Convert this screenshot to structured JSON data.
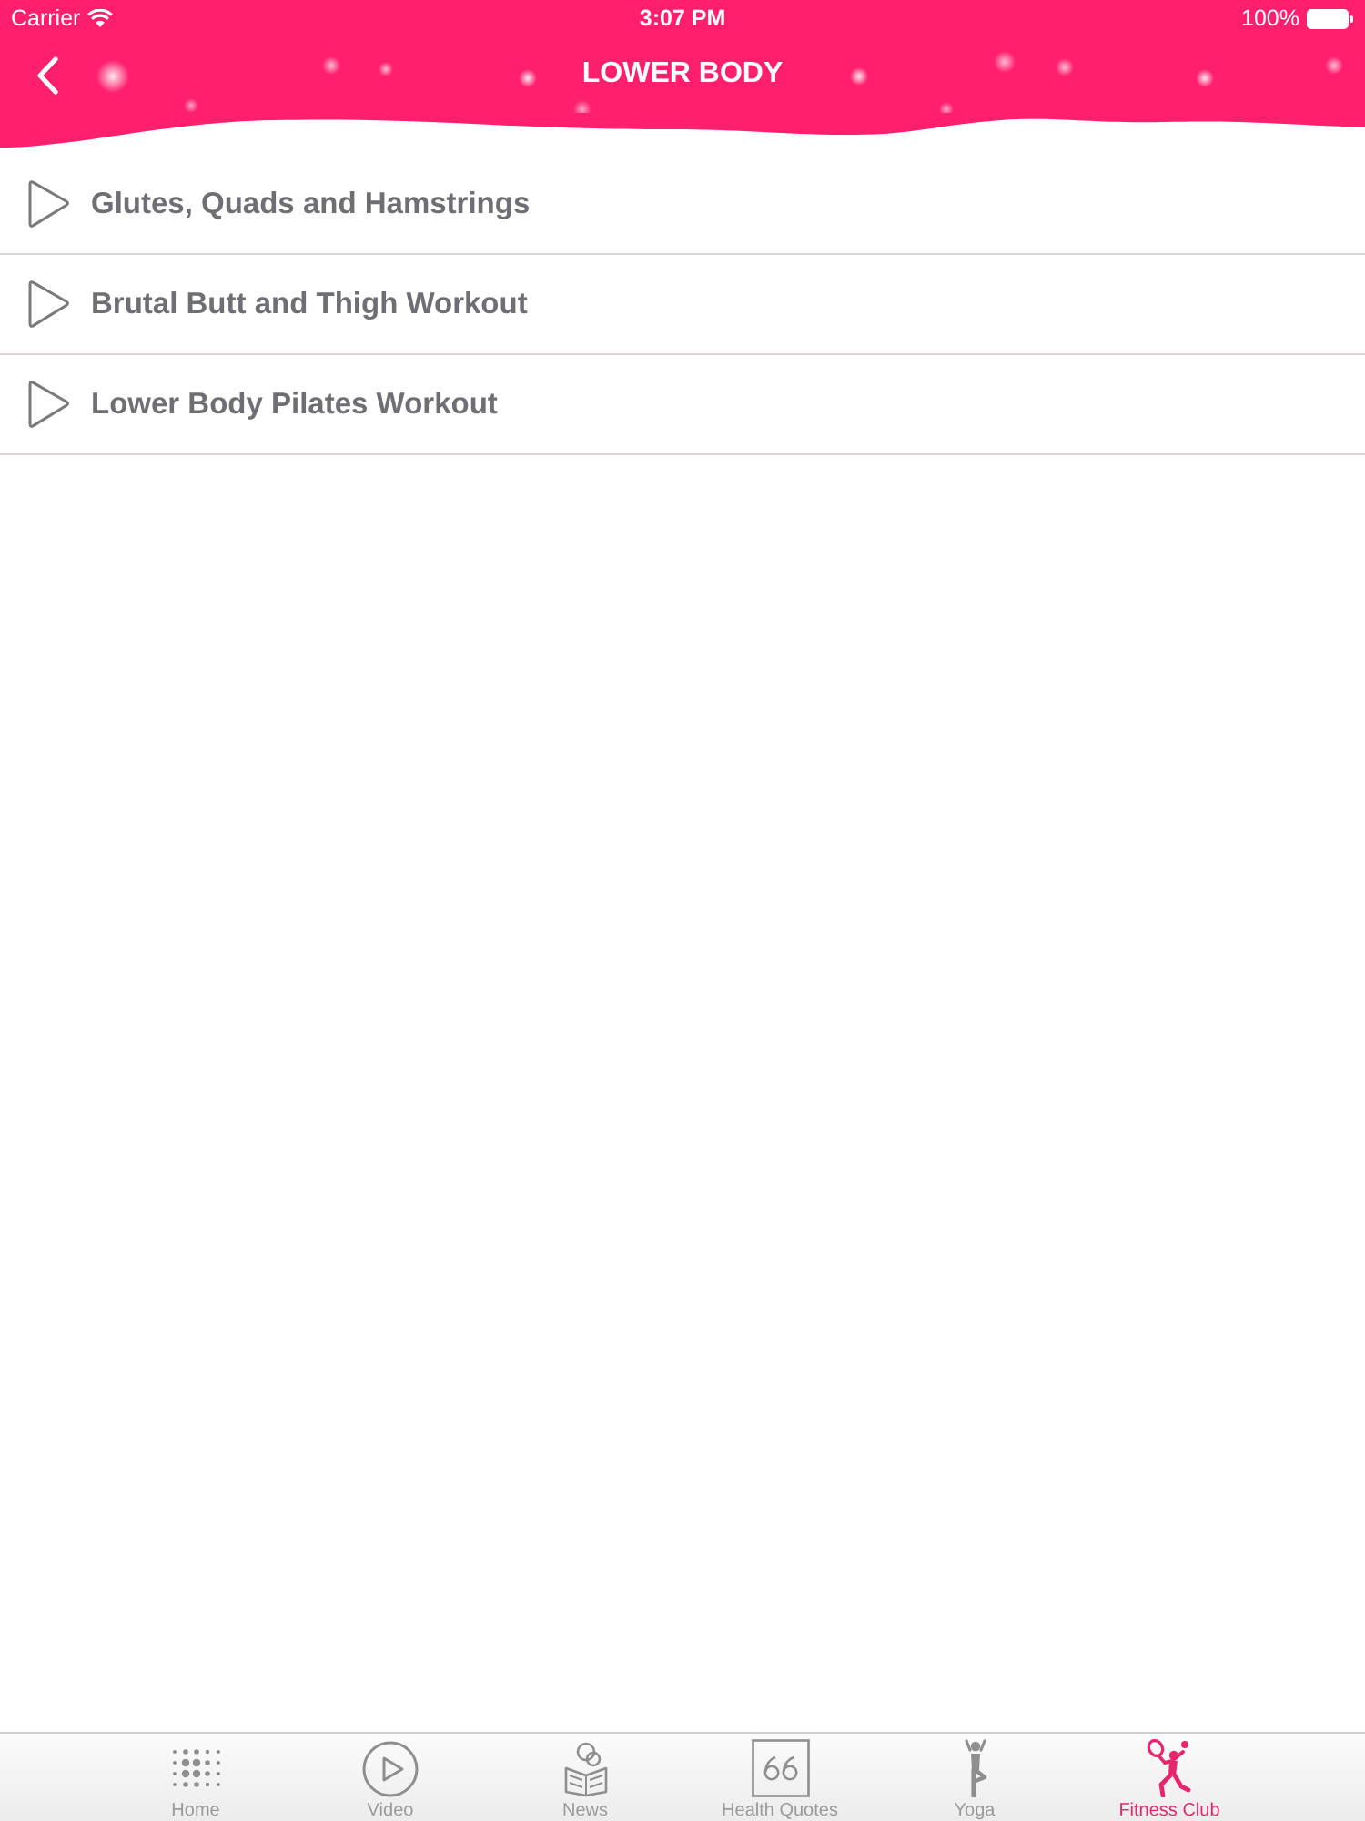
{
  "status_bar": {
    "carrier": "Carrier",
    "time": "3:07 PM",
    "battery": "100%"
  },
  "nav_bar": {
    "title": "LOWER BODY"
  },
  "rows": [
    {
      "title": "Glutes, Quads and Hamstrings"
    },
    {
      "title": "Brutal Butt and Thigh Workout"
    },
    {
      "title": "Lower Body Pilates Workout"
    }
  ],
  "tab_bar": [
    {
      "label": "Home",
      "selected": false
    },
    {
      "label": "Video",
      "selected": false
    },
    {
      "label": "News",
      "selected": false
    },
    {
      "label": "Health Quotes",
      "selected": false
    },
    {
      "label": "Yoga",
      "selected": false
    },
    {
      "label": "Fitness Club",
      "selected": true
    }
  ]
}
